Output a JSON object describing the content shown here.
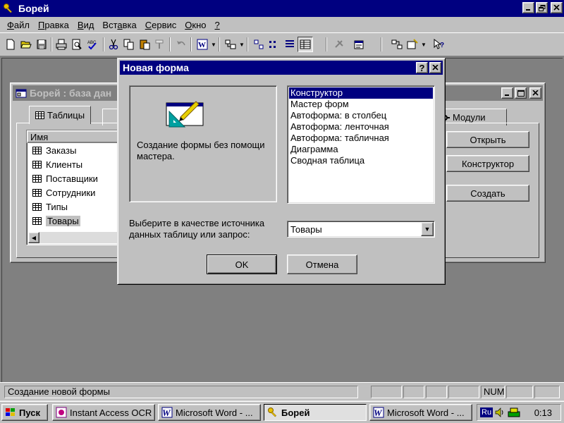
{
  "window": {
    "title": "Борей"
  },
  "menu": [
    {
      "label": "Файл",
      "u": "Ф",
      "rest": "айл"
    },
    {
      "label": "Правка",
      "u": "П",
      "rest": "равка"
    },
    {
      "label": "Вид",
      "u": "В",
      "rest": "ид"
    },
    {
      "label": "Вставка",
      "u": "",
      "pre": "Вст",
      "mid": "а",
      "post": "вка"
    },
    {
      "label": "Сервис",
      "u": "С",
      "rest": "ервис"
    },
    {
      "label": "Окно",
      "u": "О",
      "rest": "кно"
    },
    {
      "label": "?",
      "u": "?",
      "rest": ""
    }
  ],
  "database_window": {
    "title": "Борей : база дан",
    "tabs": {
      "tables": "Таблицы",
      "modules": "Модули"
    },
    "list_header": "Имя",
    "tables": [
      "Заказы",
      "Клиенты",
      "Поставщики",
      "Сотрудники",
      "Типы",
      "Товары"
    ],
    "selected_table": "Товары",
    "buttons": {
      "open": "Открыть",
      "design": "Конструктор",
      "create": "Создать"
    }
  },
  "dialog": {
    "title": "Новая форма",
    "description": "Создание формы без помощи мастера.",
    "form_types": [
      "Конструктор",
      "Мастер форм",
      "Автоформа:  в столбец",
      "Автоформа:  ленточная",
      "Автоформа:  табличная",
      "Диаграмма",
      "Сводная таблица"
    ],
    "selected_type": "Конструктор",
    "source_label": "Выберите в качестве источника данных таблицу или запрос:",
    "source_value": "Товары",
    "ok": "OK",
    "cancel": "Отмена"
  },
  "statusbar": {
    "text": "Создание новой формы",
    "num": "NUM"
  },
  "taskbar": {
    "start": "Пуск",
    "tasks": [
      "Instant Access OCR",
      "Microsoft Word - ...",
      "Борей",
      "Microsoft Word - ..."
    ],
    "active_task": "Борей",
    "lang": "Ru",
    "clock": "0:13"
  },
  "colors": {
    "title_active": "#000080",
    "title_inactive": "#808080",
    "face": "#c0c0c0",
    "desktop": "#808080"
  }
}
